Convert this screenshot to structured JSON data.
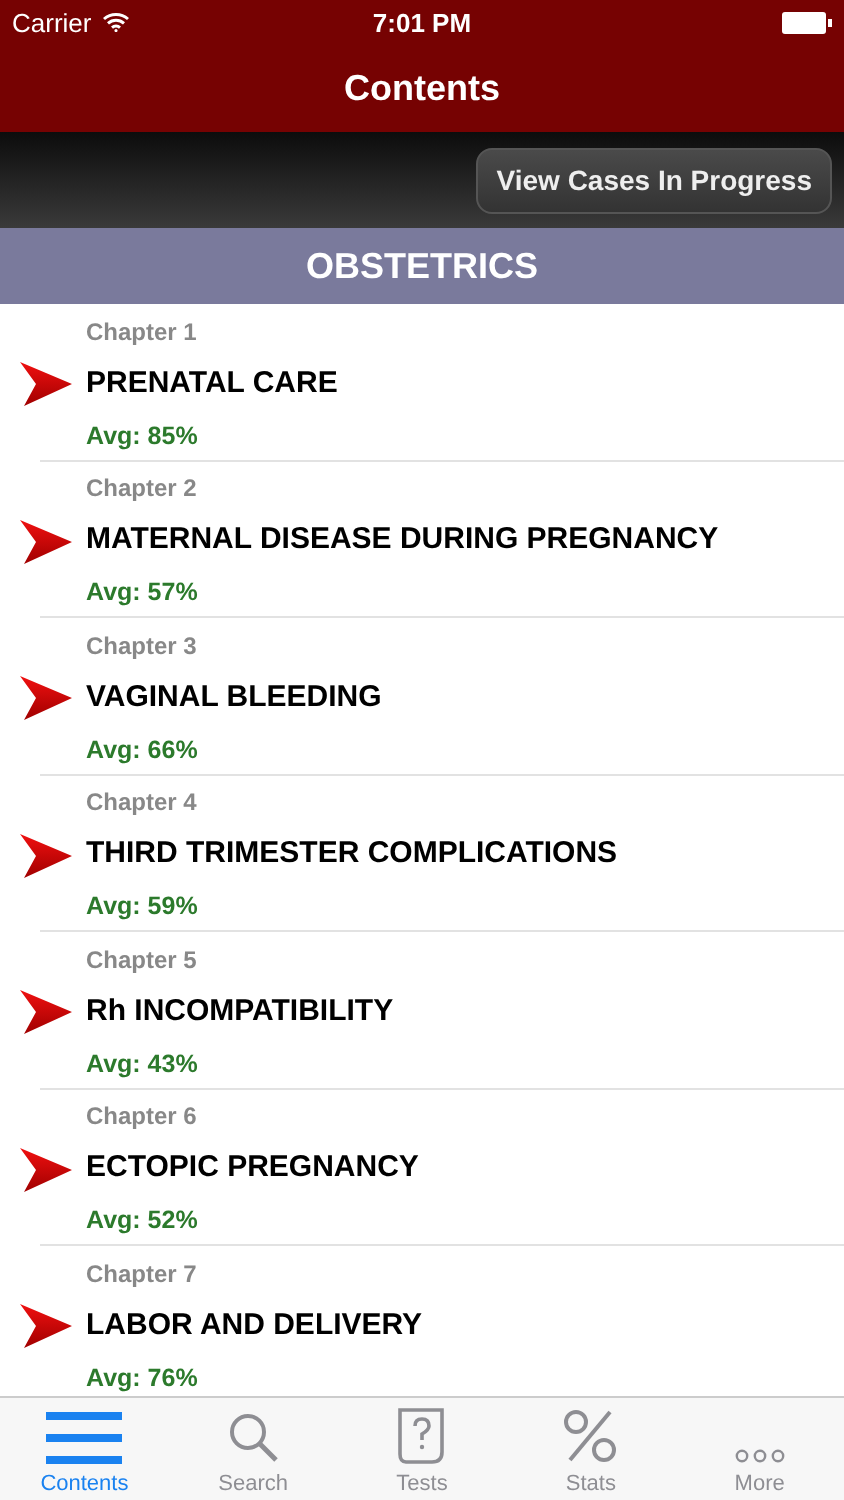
{
  "status_bar": {
    "carrier": "Carrier",
    "time": "7:01 PM"
  },
  "nav": {
    "title": "Contents"
  },
  "toolbar": {
    "button": "View Cases In Progress"
  },
  "section": {
    "title": "OBSTETRICS"
  },
  "chapters": [
    {
      "chapter": "Chapter 1",
      "title": "PRENATAL CARE",
      "avg": "Avg: 85%"
    },
    {
      "chapter": "Chapter 2",
      "title": "MATERNAL DISEASE DURING PREGNANCY",
      "avg": "Avg: 57%"
    },
    {
      "chapter": "Chapter 3",
      "title": "VAGINAL BLEEDING",
      "avg": "Avg: 66%"
    },
    {
      "chapter": "Chapter 4",
      "title": "THIRD TRIMESTER COMPLICATIONS",
      "avg": "Avg: 59%"
    },
    {
      "chapter": "Chapter 5",
      "title": "Rh INCOMPATIBILITY",
      "avg": "Avg: 43%"
    },
    {
      "chapter": "Chapter 6",
      "title": "ECTOPIC PREGNANCY",
      "avg": "Avg: 52%"
    },
    {
      "chapter": "Chapter 7",
      "title": "LABOR AND DELIVERY",
      "avg": "Avg: 76%"
    }
  ],
  "tabs": [
    {
      "kind": "contents",
      "label": "Contents",
      "selected": true
    },
    {
      "kind": "search",
      "label": "Search",
      "selected": false
    },
    {
      "kind": "tests",
      "label": "Tests",
      "selected": false
    },
    {
      "kind": "stats",
      "label": "Stats",
      "selected": false
    },
    {
      "kind": "more",
      "label": "More",
      "selected": false
    }
  ]
}
